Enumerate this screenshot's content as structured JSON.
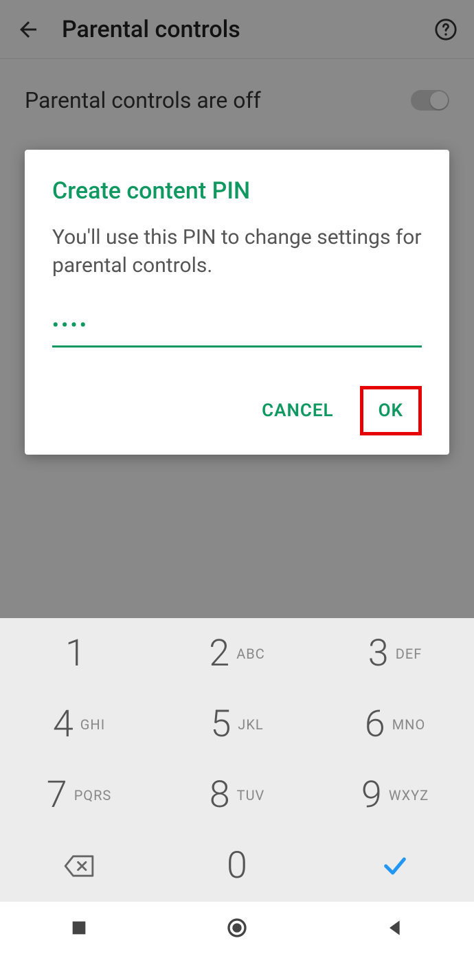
{
  "header": {
    "title": "Parental controls"
  },
  "settings_row": {
    "label": "Parental controls are off",
    "enabled": false
  },
  "dialog": {
    "title": "Create content PIN",
    "body": "You'll use this PIN to change settings for parental controls.",
    "pin_masked": "••••",
    "cancel_label": "CANCEL",
    "ok_label": "OK"
  },
  "keypad": {
    "keys": [
      {
        "digit": "1",
        "letters": ""
      },
      {
        "digit": "2",
        "letters": "ABC"
      },
      {
        "digit": "3",
        "letters": "DEF"
      },
      {
        "digit": "4",
        "letters": "GHI"
      },
      {
        "digit": "5",
        "letters": "JKL"
      },
      {
        "digit": "6",
        "letters": "MNO"
      },
      {
        "digit": "7",
        "letters": "PQRS"
      },
      {
        "digit": "8",
        "letters": "TUV"
      },
      {
        "digit": "9",
        "letters": "WXYZ"
      }
    ],
    "zero": "0"
  },
  "colors": {
    "accent": "#0f9960",
    "highlight_box": "#e60000"
  }
}
